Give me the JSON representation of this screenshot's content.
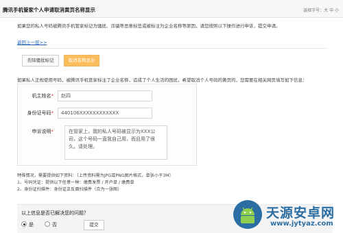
{
  "header": {
    "title": "腾讯手机管家个人申请取消黄页名称显示",
    "font_size_label": "选择字号：大 中 小"
  },
  "intro": "如果您的私人号码被腾讯手机管家标记为骚扰、诈骗等恶意标签或被标注为企业名称等原因，请您按照以下操作进行申诉，提交申请。",
  "back_link": "返回上一层>>",
  "tabs": {
    "remove_harass": "去除骚扰标记",
    "cancel_name": "取消名称显示"
  },
  "description": "如果私人正规使用号码，被腾讯手机管家标注了企业名称，造成了个人生活的困扰，希望取消个人号码的黄页的，您需要在相关网页填写如下信息：",
  "form": {
    "owner_label": "机主姓名",
    "owner_value": "赵四",
    "id_label": "身份证号码",
    "id_value": "440106XXXXXXXXXXXX",
    "reason_label": "申诉说明",
    "reason_value": "在管家上，我的私人号码被显示为XXX公司，这个号码一直我自己用，而且用了很久。请处理。",
    "required_mark": "*"
  },
  "special": {
    "line1": "特殊情况，需要提供如下资料：（上传资料需为JPG或PNG图片格式，单张小于3M）",
    "line2": "1、号码凭证：提供以下任意一种：缴费发票 / 开户单 / 缴费单",
    "line3": "2、身份证扫描件：身份证正反面扫描件（合为一张图）"
  },
  "feedback": {
    "question": "以上信息是否已解决您的问题？",
    "yes_label": "是",
    "no_label": "否",
    "submit_label": "提交"
  },
  "watermark": {
    "brand": "天源安卓网",
    "url": "www.jytyaz.com",
    "color": "#2b6ea3"
  }
}
